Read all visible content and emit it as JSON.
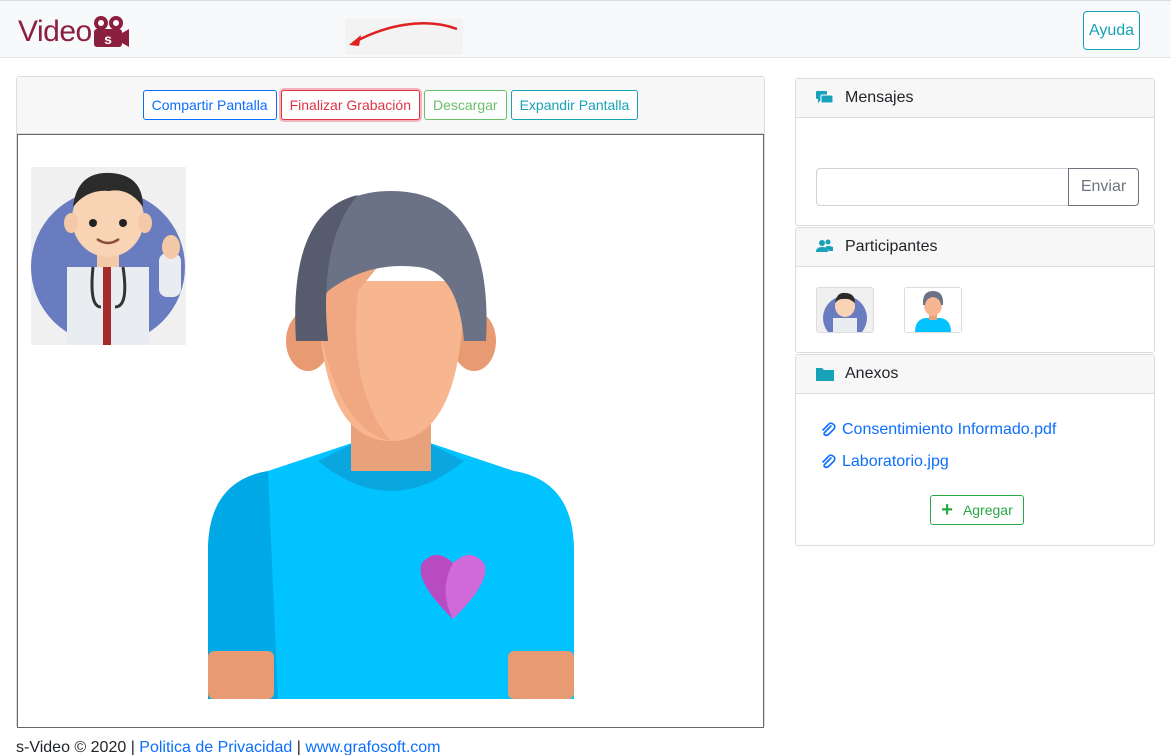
{
  "navbar": {
    "brand_text": "Video",
    "brand_badge": "s",
    "help_label": "Ayuda"
  },
  "toolbar": {
    "share_label": "Compartir Pantalla",
    "stop_label": "Finalizar Grabación",
    "download_label": "Descargar",
    "expand_label": "Expandir Pantalla"
  },
  "messages": {
    "title": "Mensajes",
    "input_value": "",
    "send_label": "Enviar"
  },
  "participants": {
    "title": "Participantes",
    "items": [
      {
        "role": "doctor"
      },
      {
        "role": "patient"
      }
    ]
  },
  "annexes": {
    "title": "Anexos",
    "files": [
      {
        "name": "Consentimiento Informado.pdf"
      },
      {
        "name": "Laboratorio.jpg"
      }
    ],
    "add_label": "Agregar"
  },
  "footer": {
    "copyright": "s-Video © 2020",
    "sep": "|",
    "privacy_label": "Politica de Privacidad",
    "site_label": "www.grafosoft.com"
  },
  "colors": {
    "brand": "#8b1f3f",
    "primary": "#0d6efd",
    "danger": "#dc3545",
    "success": "#28a745",
    "info": "#17a2b8",
    "shirt": "#00c3ff",
    "heart": "#c850c0"
  }
}
